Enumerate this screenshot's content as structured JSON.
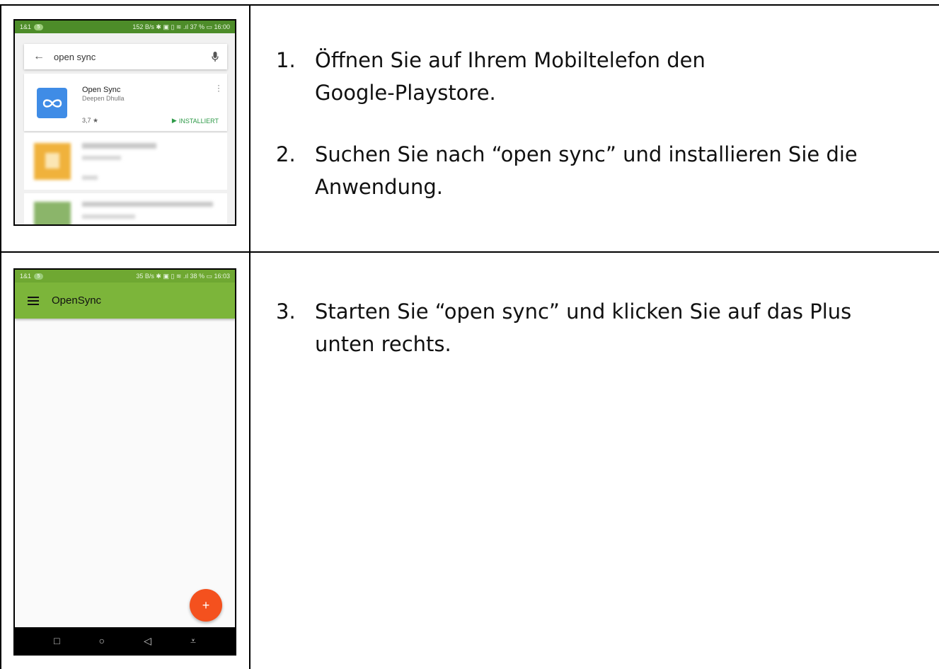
{
  "steps": [
    {
      "number": "1.",
      "line1": "Öffnen Sie auf Ihrem Mobiltelefon den",
      "line2": "Google-Playstore."
    },
    {
      "number": "2.",
      "line1": "Suchen Sie nach “open sync” und installieren Sie die",
      "line2": "Anwendung."
    },
    {
      "number": "3.",
      "line1": "Starten Sie “open sync” und klicken Sie auf das Plus",
      "line2": "unten rechts."
    }
  ],
  "phone1": {
    "status": {
      "carrier": "1&1",
      "badge": "5",
      "right": "152 B/s ✱ ▣ ▯ ≋ .ıl 37 % ▭ 16:00"
    },
    "search_query": "open sync",
    "result": {
      "name": "Open Sync",
      "developer": "Deepen Dhulla",
      "rating": "3,7 ★",
      "install_label": "INSTALLIERT"
    }
  },
  "phone2": {
    "status": {
      "carrier": "1&1",
      "badge": "5",
      "right": "35 B/s ✱ ▣ ▯ ≋ .ıl 38 % ▭ 16:03"
    },
    "app_title": "OpenSync",
    "fab_label": "+",
    "nav": [
      "□",
      "○",
      "◁",
      "⩡"
    ]
  },
  "colors": {
    "playstore_status": "#4d8c29",
    "opensync_appbar": "#7cb53a",
    "fab": "#f4511e",
    "installed": "#2e9a48",
    "app_icon": "#3f8ce6"
  }
}
